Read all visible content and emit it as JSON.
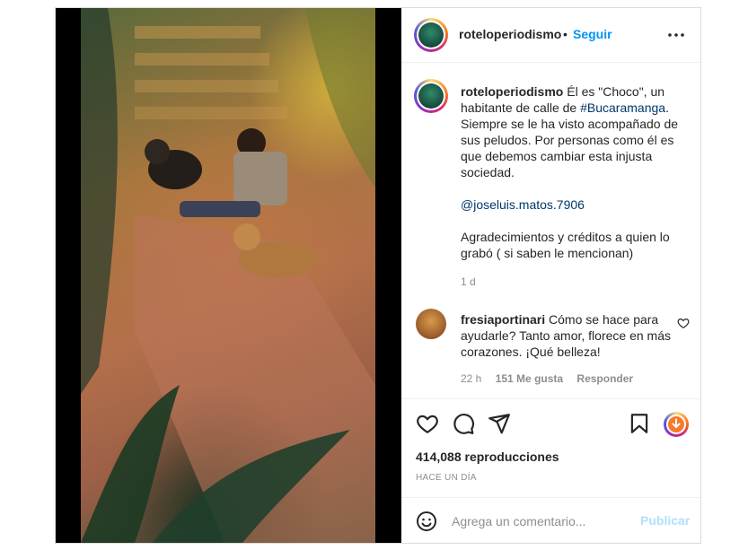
{
  "post": {
    "username": "roteloperiodismo",
    "dot": "•",
    "follow_label": "Seguir",
    "more_icon": "more-horizontal-icon",
    "caption": {
      "line1": "Él es \"Choco\", un habitante de calle de ",
      "hashtag": "#Bucaramanga",
      "line1_end": ". Siempre se le ha visto acompañado de sus peludos. Por personas como él es que debemos cambiar esta injusta sociedad.",
      "mention": "@joseluis.matos.7906",
      "line3": "Agradecimientos y créditos a quien lo grabó ( si saben le mencionan)",
      "time": "1 d"
    },
    "comment": {
      "username": "fresiaportinari",
      "text": "Cómo se hace para ayudarle? Tanto amor, florece en más corazones. ¡Qué belleza!",
      "time": "22 h",
      "likes": "151 Me gusta",
      "reply": "Responder"
    },
    "actions": {
      "like_icon": "heart-icon",
      "comment_icon": "comment-icon",
      "share_icon": "share-icon",
      "save_icon": "bookmark-icon",
      "download_icon": "download-icon"
    },
    "views": "414,088 reproducciones",
    "date": "HACE UN DÍA",
    "add_comment": {
      "placeholder": "Agrega un comentario...",
      "publish_label": "Publicar",
      "emoji_icon": "emoji-icon"
    }
  },
  "colors": {
    "accent": "#0095f6",
    "publish_disabled": "#b2dffc",
    "text": "#262626",
    "muted": "#8e8e8e",
    "link": "#00376b"
  }
}
